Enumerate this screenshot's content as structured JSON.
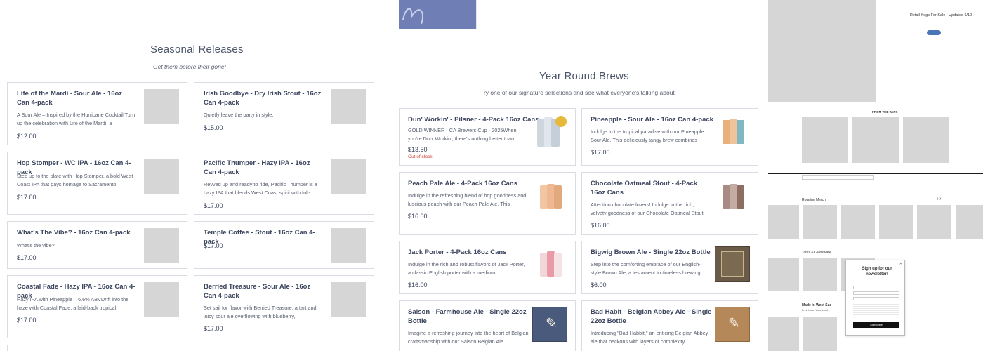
{
  "seasonal": {
    "title": "Seasonal Releases",
    "subtitle": "Get them before their gone!",
    "items": [
      {
        "title": "Life of the Mardi - Sour Ale - 16oz Can 4-pack",
        "desc": "A Sour Ale – Inspired by the Hurricane Cocktail Turn up the celebration with Life of the Mardi, a",
        "price": "$12.00"
      },
      {
        "title": "Irish Goodbye - Dry Irish Stout - 16oz Can 4-pack",
        "desc": "Quietly leave the party in style.",
        "price": "$15.00"
      },
      {
        "title": "Hop Stomper - WC IPA - 16oz Can 4-pack",
        "desc": "Step up to the plate with Hop Stomper, a bold West Coast IPA that pays homage to Sacramento",
        "price": "$17.00"
      },
      {
        "title": "Pacific Thumper - Hazy IPA - 16oz Can 4-pack",
        "desc": "Revved up and ready to ride, Pacific Thumper is a hazy IPA that blends West Coast spirit with full-",
        "price": "$17.00"
      },
      {
        "title": "What's The Vibe? - 16oz Can 4-pack",
        "desc": "What's the vibe?",
        "price": "$17.00"
      },
      {
        "title": "Temple Coffee - Stout - 16oz Can 4-pack",
        "desc": "",
        "price": "$17.00"
      },
      {
        "title": "Coastal Fade - Hazy IPA - 16oz Can 4-pack",
        "desc": "Hazy IPA with Pineapple – 6.6% ABVDrift into the haze with Coastal Fade, a laid-back tropical",
        "price": "$17.00"
      },
      {
        "title": "Berried Treasure - Sour Ale - 16oz Can 4-pack",
        "desc": "Set sail for flavor with Berried Treasure, a tart and juicy sour ale overflowing with blueberry,",
        "price": "$17.00"
      }
    ]
  },
  "yearround": {
    "title": "Year Round Brews",
    "subtitle": "Try one of our signature selections and see what everyone's talking about",
    "items": [
      {
        "title": "Dun' Workin' - Pilsner - 4-Pack 16oz Cans",
        "desc": "GOLD WINNER · CA Brewers Cup · 2025When you're Dun' Workin', there's nothing better than",
        "price": "$13.50",
        "stock": "Out of stock"
      },
      {
        "title": "Pineapple - Sour Ale - 16oz Can 4-pack",
        "desc": "Indulge in the tropical paradise with our Pineapple Sour Ale. This deliciously tangy brew combines",
        "price": "$17.00"
      },
      {
        "title": "Peach Pale Ale - 4-Pack 16oz Cans",
        "desc": "Indulge in the refreshing blend of hop goodness and luscious peach with our Peach Pale Ale. This",
        "price": "$16.00"
      },
      {
        "title": "Chocolate Oatmeal Stout - 4-Pack 16oz Cans",
        "desc": "Attention chocolate lovers! Indulge in the rich, velvety goodness of our Chocolate Oatmeal Stout",
        "price": "$16.00"
      },
      {
        "title": "Jack Porter - 4-Pack 16oz Cans",
        "desc": "Indulge in the rich and robust flavors of Jack Porter, a classic English porter with a medium",
        "price": "$16.00"
      },
      {
        "title": "Bigwig Brown Ale - Single 22oz Bottle",
        "desc": "Step into the comforting embrace of our English-style Brown Ale, a testament to timeless brewing",
        "price": "$6.00"
      },
      {
        "title": "Saison - Farmhouse Ale - Single 22oz Bottle",
        "desc": "Imagine a refreshing journey into the heart of Belgian craftsmanship with our Saison Belgian Ale",
        "price": ""
      },
      {
        "title": "Bad Habit - Belgian Abbey Ale - Single 22oz Bottle",
        "desc": "Introducing \"Bad Habbit,\" an enticing Belgian Abbey ale that beckons with layers of complexity",
        "price": ""
      }
    ]
  },
  "preview": {
    "banner": "Retail Kegs For Sale - Updated 6/10",
    "from_taps": "FROM THE TAPS",
    "rotating": "Rotating Merch",
    "totes": "Totes & Glassware",
    "made_in": "Made In West Sac",
    "made_in_sub": "Drink Local. Wear Local.",
    "newsletter_title": "Sign up for our newsletter!",
    "newsletter_btn": "Subscribe"
  },
  "colors": {
    "accent": "#4a76b8",
    "out_of_stock": "#d04a3a",
    "placeholder": "#d6d6d6"
  }
}
